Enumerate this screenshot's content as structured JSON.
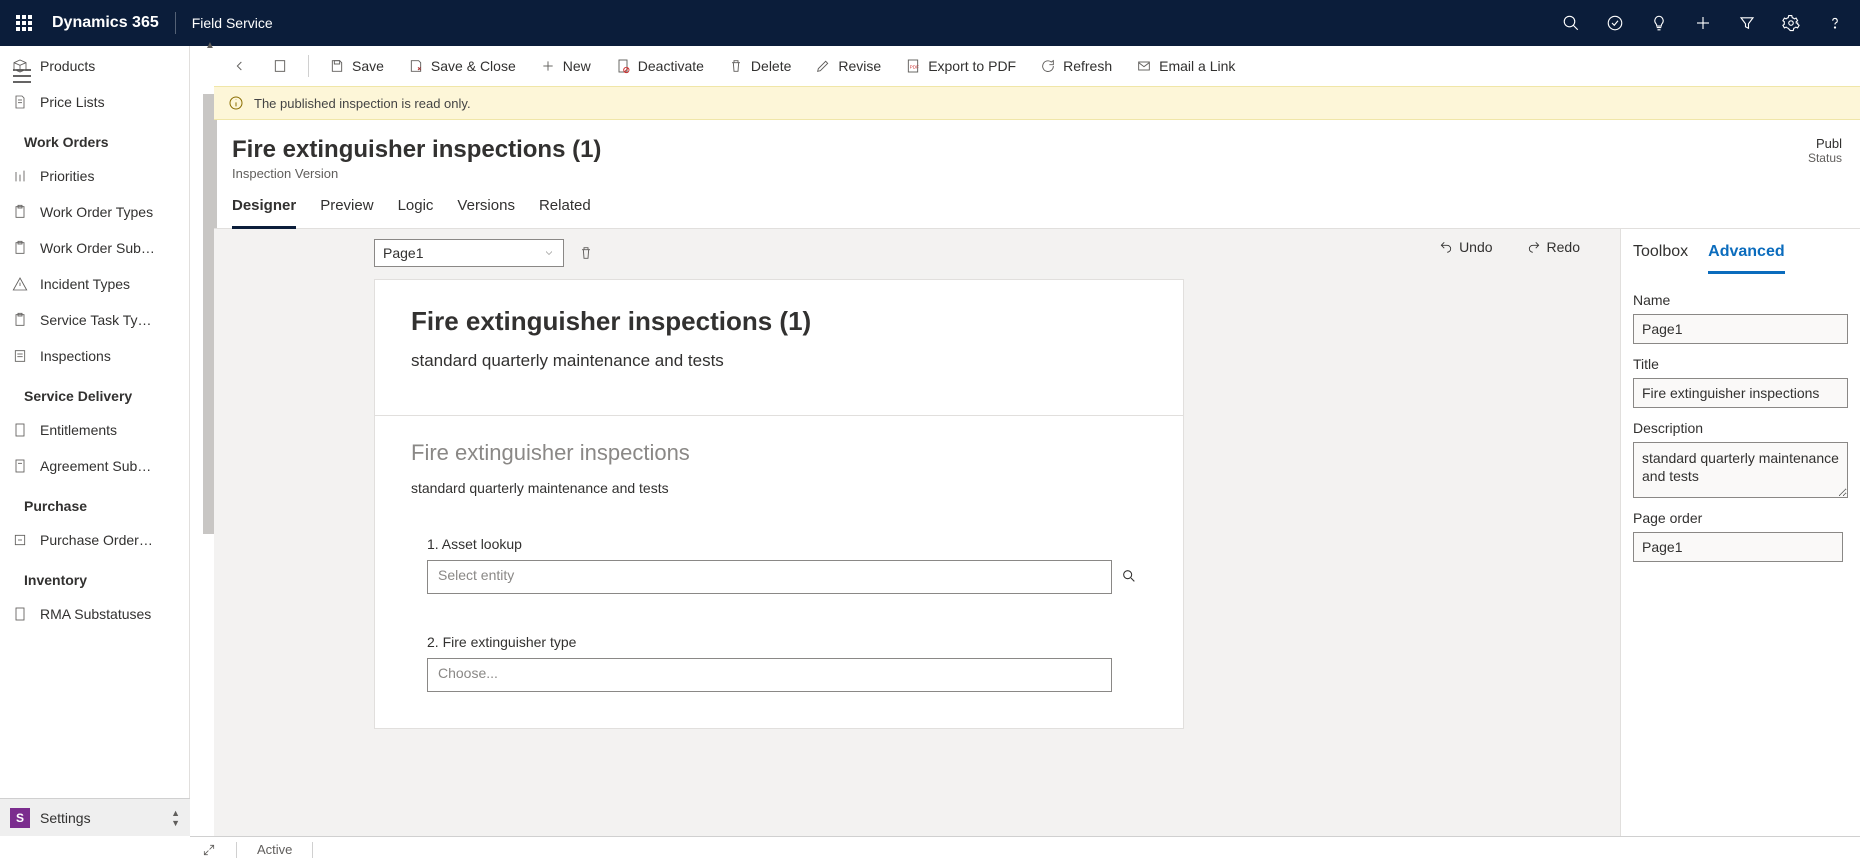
{
  "header": {
    "brand": "Dynamics 365",
    "app": "Field Service"
  },
  "sidebar": {
    "top_items": [
      {
        "label": "Products"
      },
      {
        "label": "Price Lists"
      }
    ],
    "sections": [
      {
        "title": "Work Orders",
        "items": [
          {
            "label": "Priorities"
          },
          {
            "label": "Work Order Types"
          },
          {
            "label": "Work Order Subs..."
          },
          {
            "label": "Incident Types"
          },
          {
            "label": "Service Task Types"
          },
          {
            "label": "Inspections",
            "selected": true
          }
        ]
      },
      {
        "title": "Service Delivery",
        "items": [
          {
            "label": "Entitlements"
          },
          {
            "label": "Agreement Subst..."
          }
        ]
      },
      {
        "title": "Purchase",
        "items": [
          {
            "label": "Purchase Order S..."
          }
        ]
      },
      {
        "title": "Inventory",
        "items": [
          {
            "label": "RMA Substatuses"
          }
        ]
      }
    ]
  },
  "commands": {
    "save": "Save",
    "save_close": "Save & Close",
    "new": "New",
    "deactivate": "Deactivate",
    "delete": "Delete",
    "revise": "Revise",
    "export_pdf": "Export to PDF",
    "refresh": "Refresh",
    "email_link": "Email a Link"
  },
  "notification": {
    "text": "The published inspection is read only."
  },
  "record": {
    "title": "Fire extinguisher inspections (1)",
    "subtitle": "Inspection Version",
    "status_value": "Publ",
    "status_label": "Status"
  },
  "tabs": [
    "Designer",
    "Preview",
    "Logic",
    "Versions",
    "Related"
  ],
  "designer": {
    "page_selector": "Page1",
    "undo": "Undo",
    "redo": "Redo",
    "canvas": {
      "title": "Fire extinguisher inspections (1)",
      "desc": "standard quarterly maintenance and tests",
      "section_title": "Fire extinguisher inspections",
      "section_desc": "standard quarterly maintenance and tests",
      "q1_label": "1. Asset lookup",
      "q1_placeholder": "Select entity",
      "q2_label": "2. Fire extinguisher type",
      "q2_placeholder": "Choose..."
    }
  },
  "side_panel": {
    "tabs": [
      "Toolbox",
      "Advanced"
    ],
    "name_label": "Name",
    "name_value": "Page1",
    "title_label": "Title",
    "title_value": "Fire extinguisher inspections",
    "desc_label": "Description",
    "desc_value": "standard quarterly maintenance and tests",
    "pageorder_label": "Page order",
    "pageorder_value": "Page1"
  },
  "area_selector": {
    "initial": "S",
    "label": "Settings"
  },
  "statusbar": {
    "status": "Active"
  }
}
